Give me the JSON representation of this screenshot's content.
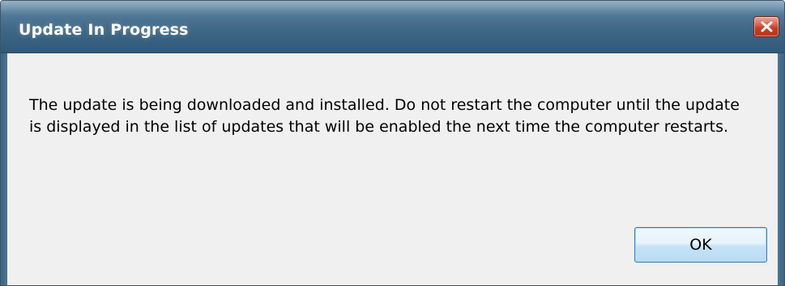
{
  "dialog": {
    "title": "Update In Progress",
    "message": "The update is being downloaded and installed. Do not restart the computer until the update is displayed in the list of updates that will be enabled the next time the computer restarts.",
    "ok_label": "OK"
  },
  "icons": {
    "close": "close-icon"
  },
  "colors": {
    "titlebar": "#3f6786",
    "close_button": "#c23b22",
    "dialog_background": "#f0f0f0",
    "button_border": "#3c7fb1"
  }
}
